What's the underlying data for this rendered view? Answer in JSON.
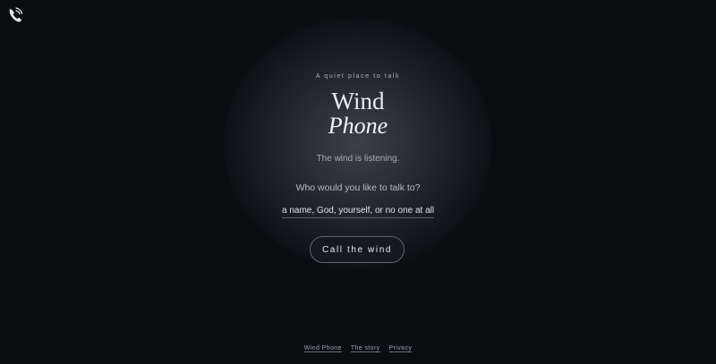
{
  "header": {
    "logo_icon": "phone-wind-icon"
  },
  "hero": {
    "tagline": "A quiet place to talk",
    "title_line1": "Wind",
    "title_line2": "Phone",
    "status": "The wind is listening."
  },
  "form": {
    "question": "Who would you like to talk to?",
    "input_value": "",
    "input_placeholder": "a name, God, yourself, or no one at all",
    "submit_label": "Call the wind"
  },
  "footer": {
    "links": [
      "Wind Phone",
      "The story",
      "Privacy"
    ]
  },
  "colors": {
    "background": "#0b0d11",
    "glow": "#3b4048",
    "text": "#e9ecf0",
    "muted": "#a7adb6"
  }
}
